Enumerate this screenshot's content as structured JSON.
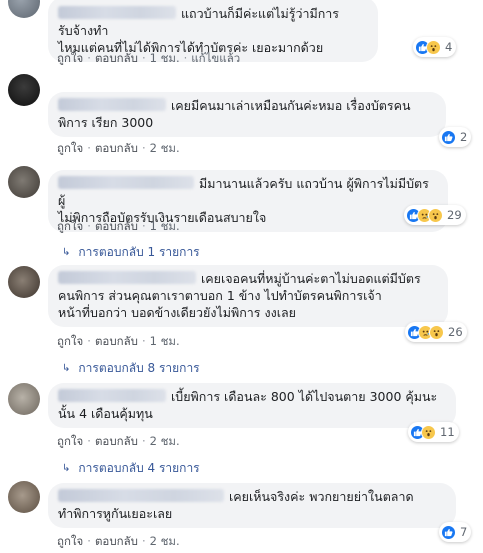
{
  "labels": {
    "like": "ถูกใจ",
    "reply": "ตอบกลับ",
    "dot": "·"
  },
  "comments": [
    {
      "text": "แถวบ้านก็มีค่ะแต่ไม่รู้ว่ามีการรับจ้างทำ\nไหมแต่คนที่ไม่ได้พิการได้ทำบัตรค่ะ เยอะมากด้วย",
      "time": "1 ชม.",
      "edited": "แก้ไขแล้ว",
      "reaction_count": "4",
      "reactions": [
        "like",
        "wow"
      ]
    },
    {
      "text": "เคยมีคนมาเล่าเหมือนกันค่ะหมอ เรื่องบัตรคน\nพิการ เรียก 3000",
      "time": "2 ชม.",
      "reaction_count": "2",
      "reactions": [
        "like"
      ]
    },
    {
      "text": "มีมานานแล้วครับ แถวบ้าน ผู้พิการไม่มีบัตร ผู้\nไม่พิการถือบัตรรับเงินรายเดือนสบายใจ",
      "time": "1 ชม.",
      "reaction_count": "29",
      "reactions": [
        "like",
        "sad",
        "wow"
      ],
      "replies": "การตอบกลับ 1 รายการ"
    },
    {
      "text": "เคยเจอคนที่หมู่บ้านค่ะตาไม่บอดแต่มีบัตร\nคนพิการ ส่วนคุณตาเราตาบอก 1 ข้าง ไปทำบัตรคนพิการเจ้า\nหน้าที่บอกว่า บอดข้างเดียวยังไม่พิการ งงเลย",
      "time": "1 ชม.",
      "reaction_count": "26",
      "reactions": [
        "like",
        "sad",
        "wow"
      ],
      "replies": "การตอบกลับ 8 รายการ"
    },
    {
      "text": "เบี้ยพิการ เดือนละ 800 ได้ไปจนตาย 3000 คุ้มนะ\nนั้น 4 เดือนคุ้มทุน",
      "time": "2 ชม.",
      "reaction_count": "11",
      "reactions": [
        "like",
        "wow"
      ],
      "replies": "การตอบกลับ 4 รายการ"
    },
    {
      "text": "เคยเห็นจริงค่ะ พวกยายย่าในตลาด\nทำพิการหูกันเยอะเลย",
      "time": "2 ชม.",
      "reaction_count": "7",
      "reactions": [
        "like"
      ]
    }
  ]
}
